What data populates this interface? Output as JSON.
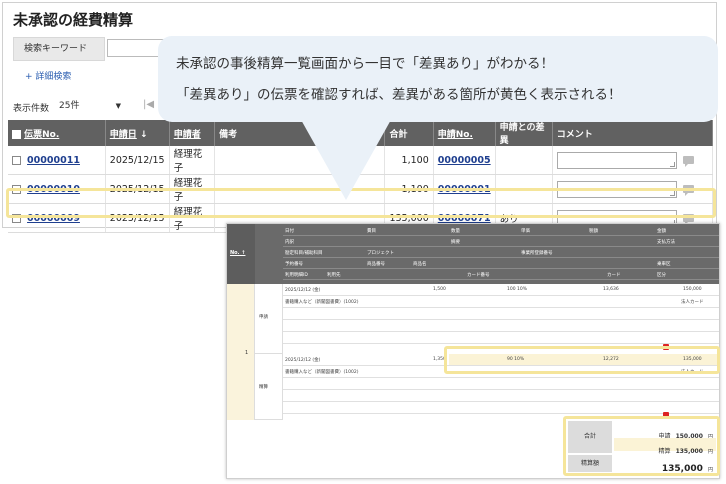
{
  "page_title": "未承認の経費精算",
  "search": {
    "label": "検索キーワード",
    "value": ""
  },
  "advanced_search": "+ 詳細検索",
  "display_count": {
    "label": "表示件数",
    "value": "25件"
  },
  "pager_first": "|◀",
  "list": {
    "headers": [
      "伝票No.",
      "申請日",
      "申請者",
      "備考",
      "合計",
      "申請No.",
      "申請との差異",
      "コメント"
    ],
    "sort_indicator": "↓",
    "rows": [
      {
        "slip": "00000011",
        "date": "2025/12/15",
        "applicant": "経理花子",
        "note": "",
        "total": "1,100",
        "app_no": "00000005",
        "diff": "",
        "comment": ""
      },
      {
        "slip": "00000010",
        "date": "2025/12/15",
        "applicant": "経理花子",
        "note": "",
        "total": "1,100",
        "app_no": "00000001",
        "diff": "",
        "comment": ""
      },
      {
        "slip": "00000009",
        "date": "2025/12/15",
        "applicant": "経理花子",
        "note": "",
        "total": "135,000",
        "app_no": "00000071",
        "diff": "あり",
        "comment": ""
      }
    ]
  },
  "callout": {
    "line1": "未承認の事後精算一覧画面から一目で「差異あり」がわかる！",
    "line2": "「差異あり」の伝票を確認すれば、差異がある箇所が黄色く表示される！"
  },
  "detail": {
    "no_header": "No. ↑",
    "row_no": "1",
    "header_rows": [
      [
        "日付",
        "費目",
        "数量",
        "単価",
        "税額",
        "金額"
      ],
      [
        "内訳",
        "摘要",
        "支払方法"
      ],
      [
        "勘定科目/補助科目",
        "プロジェクト",
        "事業所登録番号"
      ],
      [
        "予約番号",
        "商品番号",
        "商品名",
        "乗車区"
      ],
      [
        "利用明細ID",
        "利用先",
        "カード番号",
        "カード",
        "区分"
      ]
    ],
    "application": {
      "label": "申請",
      "date": "2025/12/12 (金)",
      "qty": "1,500",
      "unit": "100 10%",
      "tax": "13,636",
      "amount": "150,000",
      "item": "書籍購入など（新聞図書費）(1002)",
      "pay": "法人カード"
    },
    "settlement": {
      "label": "精算",
      "date": "2025/12/12 (金)",
      "qty": "1,350",
      "unit": "90 10%",
      "tax": "12,272",
      "amount": "135,000",
      "item": "書籍購入など（新聞図書費）(1002)",
      "pay": "法人カード"
    },
    "totals": {
      "total_label": "合計",
      "app_label": "申請",
      "app_value": "150,000",
      "set_label": "精算",
      "set_value": "135,000",
      "amount_label": "精算額",
      "amount_value": "135,000",
      "unit": "円"
    }
  }
}
